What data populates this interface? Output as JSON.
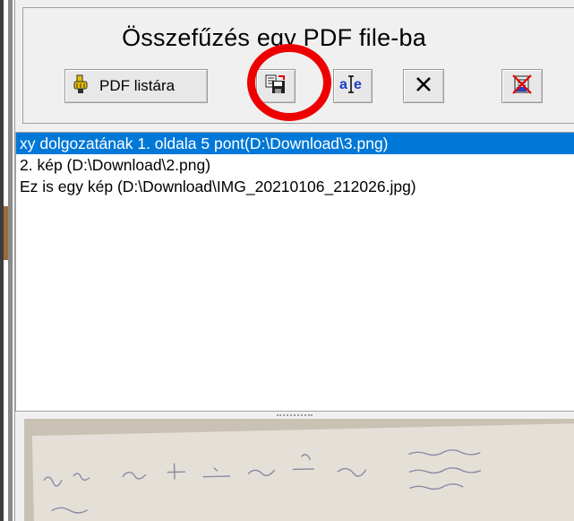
{
  "header": {
    "title": "Összefűzés egy PDF file-ba"
  },
  "toolbar": {
    "pdf_list_label": "PDF listára",
    "pdf_list_icon": "hand-pointer-icon",
    "save_icon": "copy-save-icon",
    "ocr_icon": "text-cursor-icon",
    "delete_icon": "close-icon",
    "clear_icon": "clear-list-icon"
  },
  "list": {
    "items": [
      "xy dolgozatának 1. oldala 5 pont(D:\\Download\\3.png)",
      "2. kép (D:\\Download\\2.png)",
      "Ez is egy kép (D:\\Download\\IMG_20210106_212026.jpg)"
    ],
    "selected_index": 0
  },
  "colors": {
    "selection": "#0078d7",
    "highlight_ring": "#ee0000",
    "window_bg": "#f0f0f0"
  }
}
